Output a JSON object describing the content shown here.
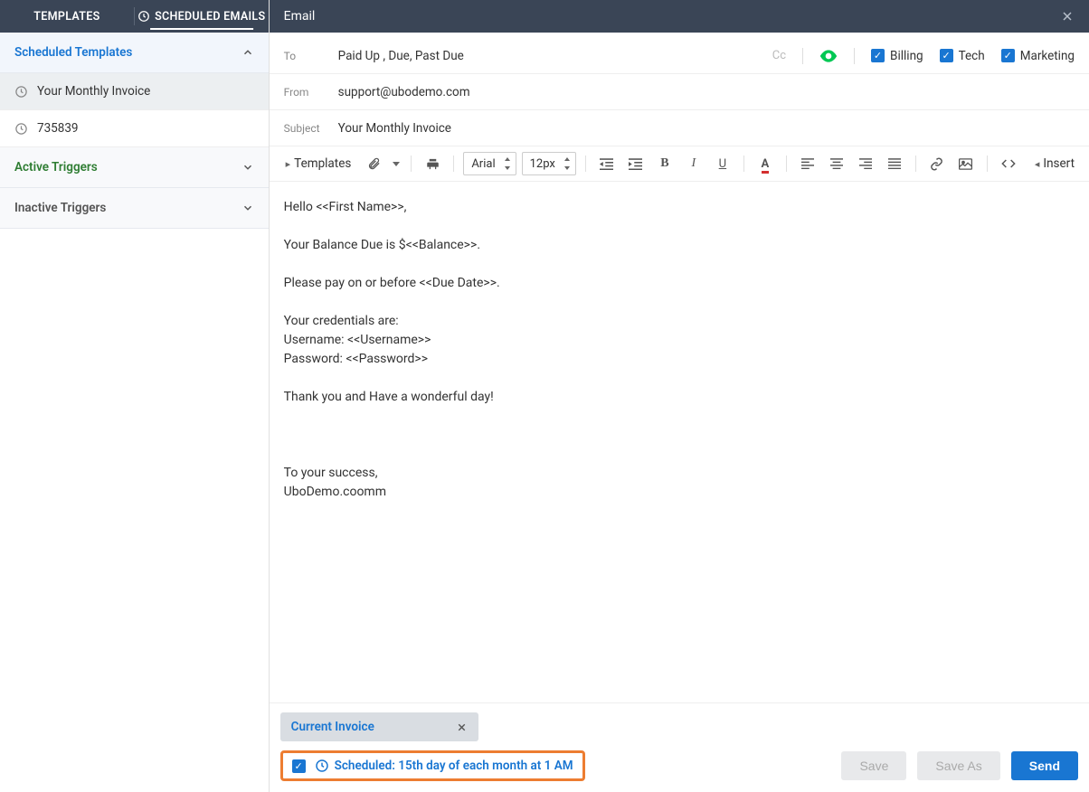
{
  "tabs": {
    "templates": "TEMPLATES",
    "scheduled": "SCHEDULED EMAILS"
  },
  "sidebar": {
    "groups": [
      {
        "title": "Scheduled Templates",
        "expanded": true
      },
      {
        "title": "Active Triggers",
        "expanded": false
      },
      {
        "title": "Inactive Triggers",
        "expanded": false
      }
    ],
    "items": [
      {
        "label": "Your Monthly Invoice"
      },
      {
        "label": "735839"
      }
    ]
  },
  "header": {
    "title": "Email"
  },
  "form": {
    "to_label": "To",
    "to_value": "Paid Up , Due, Past Due",
    "from_label": "From",
    "from_value": "support@ubodemo.com",
    "subject_label": "Subject",
    "subject_value": "Your Monthly Invoice",
    "cc_label": "Cc",
    "checks": {
      "billing": "Billing",
      "tech": "Tech",
      "marketing": "Marketing"
    }
  },
  "toolbar": {
    "templates": "Templates",
    "font": "Arial",
    "size": "12px",
    "insert": "Insert"
  },
  "body": "Hello <<First Name>>,\n\nYour Balance Due is $<<Balance>>.\n\nPlease pay on or before <<Due Date>>.\n\nYour credentials are:\nUsername: <<Username>>\nPassword: <<Password>>\n\nThank you and Have a wonderful day!\n\n\n\nTo your success,\nUboDemo.coomm",
  "attachment": {
    "name": "Current Invoice"
  },
  "schedule": {
    "text": "Scheduled: 15th day of each month at 1 AM"
  },
  "buttons": {
    "save": "Save",
    "save_as": "Save As",
    "send": "Send"
  }
}
